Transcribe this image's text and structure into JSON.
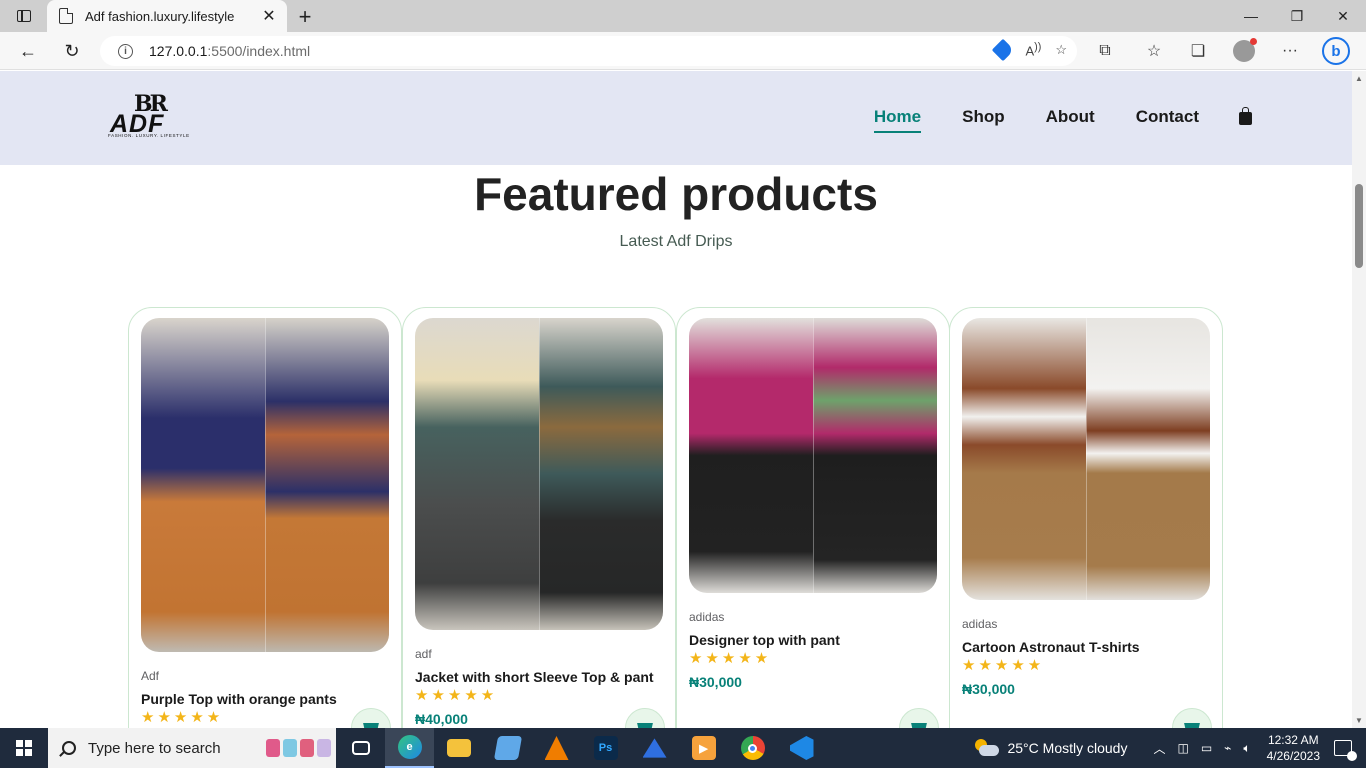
{
  "browser": {
    "tab_title": "Adf fashion.luxury.lifestyle",
    "url_host": "127.0.0.1",
    "url_path": ":5500/index.html",
    "accent": "#1a73e8"
  },
  "site": {
    "logo": {
      "mono": "BR",
      "wordmark": "ADF",
      "tagline": "FASHION. LUXURY. LIFESTYLE"
    },
    "nav": [
      {
        "label": "Home",
        "active": true
      },
      {
        "label": "Shop",
        "active": false
      },
      {
        "label": "About",
        "active": false
      },
      {
        "label": "Contact",
        "active": false
      }
    ],
    "section_title": "Featured products",
    "section_subtitle": "Latest Adf Drips",
    "accent": "#088178",
    "products": [
      {
        "brand": "Adf",
        "name": "Purple Top with orange pants",
        "stars": "★★★★★",
        "rating": 5,
        "price": "",
        "image": "purple-top-orange-pants"
      },
      {
        "brand": "adf",
        "name": "Jacket with short Sleeve Top & pant",
        "stars": "★★★★★",
        "rating": 5,
        "price": "₦40,000",
        "image": "jacket-short-sleeve"
      },
      {
        "brand": "adidas",
        "name": "Designer top with pant",
        "stars": "★★★★★",
        "rating": 5,
        "price": "₦30,000",
        "image": "designer-top-pant"
      },
      {
        "brand": "adidas",
        "name": "Cartoon Astronaut T-shirts",
        "stars": "★★★★★",
        "rating": 5,
        "price": "₦30,000",
        "image": "cartoon-astronaut-tshirt"
      }
    ]
  },
  "taskbar": {
    "search_placeholder": "Type here to search",
    "weather": "25°C  Mostly cloudy",
    "time": "12:32 AM",
    "date": "4/26/2023",
    "apps": [
      "task-view",
      "edge",
      "file-explorer",
      "notepad",
      "vlc",
      "photoshop",
      "arc",
      "media-player",
      "chrome",
      "vscode"
    ]
  }
}
